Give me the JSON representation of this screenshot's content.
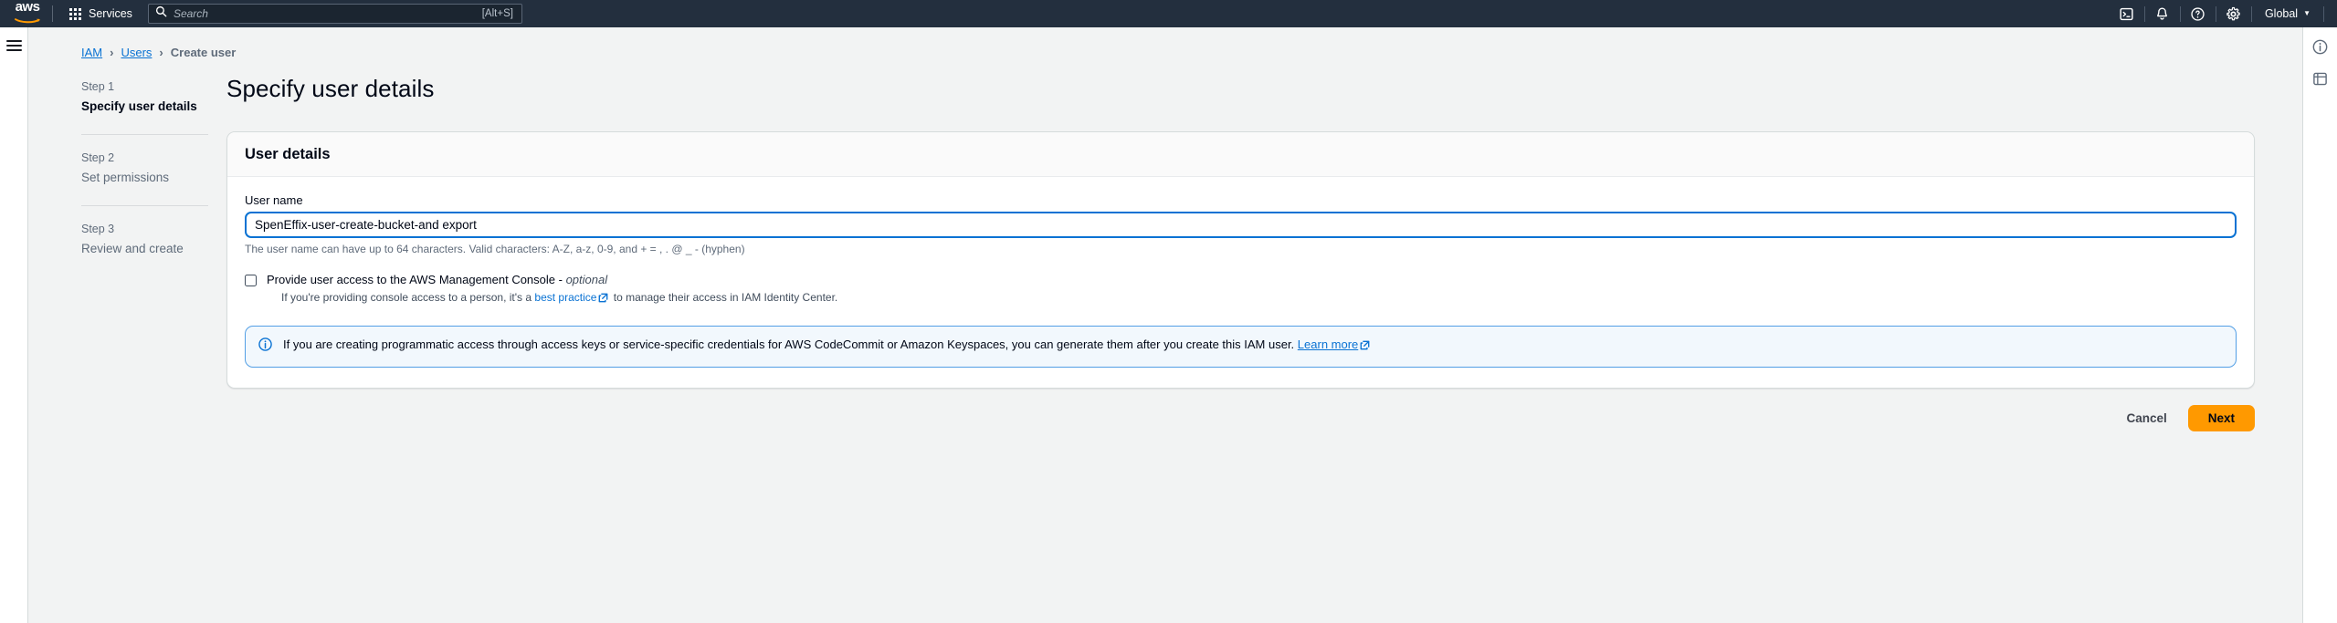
{
  "topbar": {
    "logo_text": "aws",
    "services_label": "Services",
    "search_placeholder": "Search",
    "search_value": "",
    "search_shortcut": "[Alt+S]",
    "icons": [
      "cloudshell-icon",
      "notifications-bell-icon",
      "help-question-icon",
      "settings-gear-icon"
    ],
    "region_label": "Global",
    "region_caret": "▼"
  },
  "breadcrumb": {
    "items": [
      {
        "label": "IAM",
        "link": true
      },
      {
        "label": "Users",
        "link": true
      },
      {
        "label": "Create user",
        "link": false
      }
    ],
    "separator": "›"
  },
  "steps": [
    {
      "num": "Step 1",
      "title": "Specify user details",
      "active": true
    },
    {
      "num": "Step 2",
      "title": "Set permissions",
      "active": false
    },
    {
      "num": "Step 3",
      "title": "Review and create",
      "active": false
    }
  ],
  "main": {
    "page_title": "Specify user details",
    "card_title": "User details",
    "username": {
      "label": "User name",
      "value": "SpenEffix-user-create-bucket-and export",
      "placeholder": "",
      "constraint": "The user name can have up to 64 characters. Valid characters: A-Z, a-z, 0-9, and + = , . @ _ - (hyphen)"
    },
    "console_access": {
      "checked": false,
      "label_main": "Provide user access to the AWS Management Console - ",
      "label_optional": "optional",
      "desc_before": "If you're providing console access to a person, it's a ",
      "desc_link": "best practice",
      "desc_after": " to manage their access in IAM Identity Center."
    },
    "info_alert": {
      "text": "If you are creating programmatic access through access keys or service-specific credentials for AWS CodeCommit or Amazon Keyspaces, you can generate them after you create this IAM user. ",
      "link": "Learn more"
    }
  },
  "actions": {
    "cancel_label": "Cancel",
    "next_label": "Next"
  },
  "right_rail": {
    "icons": [
      "info-circle-icon",
      "shortcuts-icon"
    ]
  },
  "colors": {
    "nav_background": "#232f3e",
    "accent_orange": "#ff9900",
    "link_blue": "#0972d3",
    "page_background": "#f2f3f3",
    "alert_background": "#f2f8fd",
    "alert_border": "#539fe5"
  }
}
